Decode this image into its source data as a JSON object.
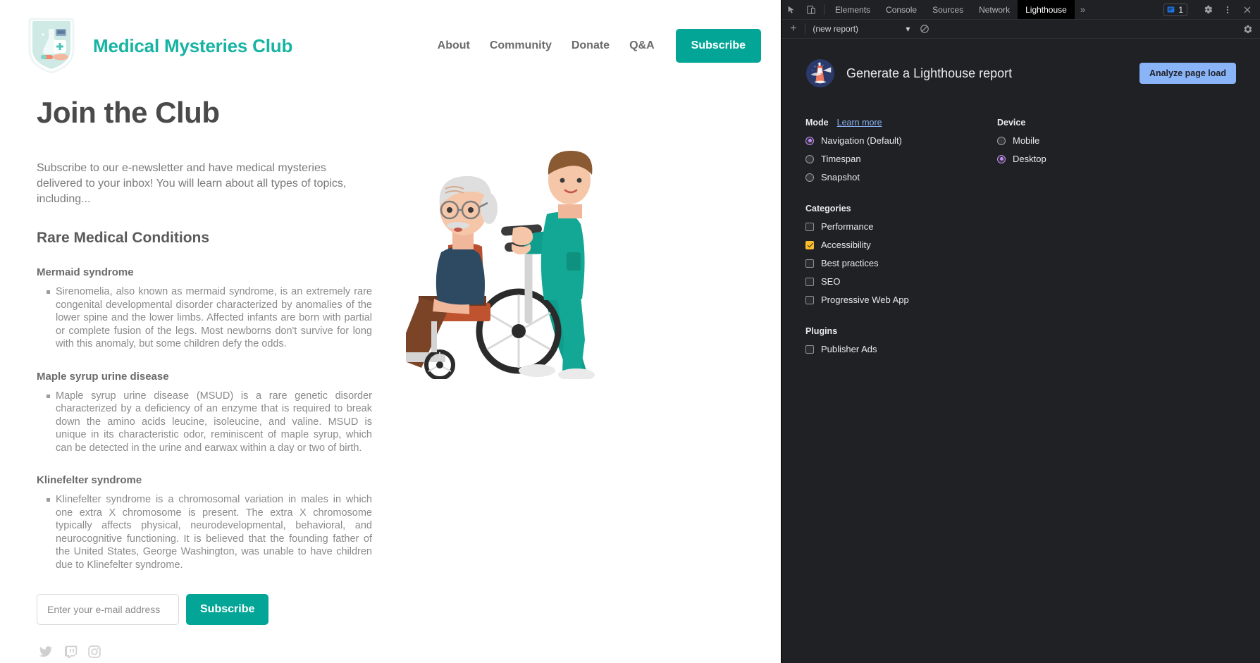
{
  "site": {
    "brand": "Medical Mysteries Club",
    "logo_icon": "medical-shield-badge-icon",
    "nav": [
      {
        "label": "About"
      },
      {
        "label": "Community"
      },
      {
        "label": "Donate"
      },
      {
        "label": "Q&A"
      }
    ],
    "nav_cta": "Subscribe",
    "accent_color": "#03a696",
    "brand_color": "#17b3a3",
    "title": "Join the Club",
    "intro": "Subscribe to our e-newsletter and have medical mysteries delivered to your inbox! You will learn about all types of topics, including...",
    "section_title": "Rare Medical Conditions",
    "conditions": [
      {
        "title": "Mermaid syndrome",
        "body": "Sirenomelia, also known as mermaid syndrome, is an extremely rare congenital developmental disorder characterized by anomalies of the lower spine and the lower limbs. Affected infants are born with partial or complete fusion of the legs. Most newborns don't survive for long with this anomaly, but some children defy the odds."
      },
      {
        "title": "Maple syrup urine disease",
        "body": "Maple syrup urine disease (MSUD) is a rare genetic disorder characterized by a deficiency of an enzyme that is required to break down the amino acids leucine, isoleucine, and valine. MSUD is unique in its characteristic odor, reminiscent of maple syrup, which can be detected in the urine and earwax within a day or two of birth."
      },
      {
        "title": "Klinefelter syndrome",
        "body": "Klinefelter syndrome is a chromosomal variation in males in which one extra X chromosome is present. The extra X chromosome typically affects physical, neurodevelopmental, behavioral, and neurocognitive functioning. It is believed that the founding father of the United States, George Washington, was unable to have children due to Klinefelter syndrome."
      }
    ],
    "signup": {
      "placeholder": "Enter your e-mail address",
      "button": "Subscribe"
    },
    "socials": [
      {
        "name": "twitter-icon"
      },
      {
        "name": "twitch-icon"
      },
      {
        "name": "instagram-icon"
      }
    ],
    "illustration": "nurse-pushing-elderly-man-in-wheelchair-illustration"
  },
  "devtools": {
    "tabs": [
      {
        "label": "Elements",
        "active": false
      },
      {
        "label": "Console",
        "active": false
      },
      {
        "label": "Sources",
        "active": false
      },
      {
        "label": "Network",
        "active": false
      },
      {
        "label": "Lighthouse",
        "active": true
      }
    ],
    "more_tabs": "»",
    "issues_count": "1",
    "toolbar": {
      "add_label": "+",
      "report_select": "(new report)",
      "select_caret": "▾"
    },
    "lighthouse": {
      "heading": "Generate a Lighthouse report",
      "analyze_button": "Analyze page load",
      "mode_label": "Mode",
      "learn_more": "Learn more",
      "modes": [
        {
          "label": "Navigation (Default)",
          "checked": true
        },
        {
          "label": "Timespan",
          "checked": false
        },
        {
          "label": "Snapshot",
          "checked": false
        }
      ],
      "device_label": "Device",
      "devices": [
        {
          "label": "Mobile",
          "checked": false
        },
        {
          "label": "Desktop",
          "checked": true
        }
      ],
      "categories_label": "Categories",
      "categories": [
        {
          "label": "Performance",
          "checked": false
        },
        {
          "label": "Accessibility",
          "checked": true
        },
        {
          "label": "Best practices",
          "checked": false
        },
        {
          "label": "SEO",
          "checked": false
        },
        {
          "label": "Progressive Web App",
          "checked": false
        }
      ],
      "plugins_label": "Plugins",
      "plugins": [
        {
          "label": "Publisher Ads",
          "checked": false
        }
      ],
      "accent_blue": "#8ab4f8",
      "checked_color": "#fdbc2c",
      "radio_color": "#c58af9"
    }
  }
}
